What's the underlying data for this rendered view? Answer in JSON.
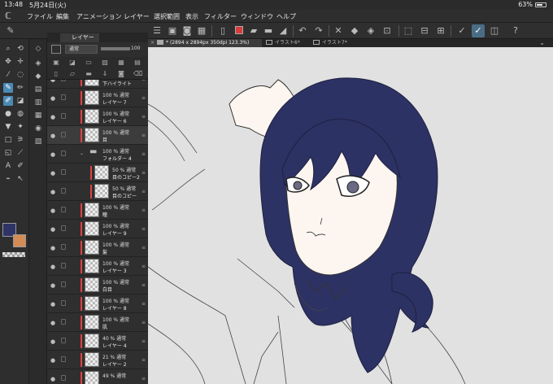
{
  "status": {
    "time": "13:48",
    "date": "5月24日(火)",
    "battery": "63%"
  },
  "menu": [
    "ファイル",
    "編集",
    "アニメーション",
    "レイヤー",
    "選択範囲",
    "表示",
    "フィルター",
    "ウィンドウ",
    "ヘルプ"
  ],
  "colors": {
    "main": "#2e3466",
    "sub": "#d48c55",
    "accent": "#4a8ab5",
    "toolbar_red": "#d93b3b"
  },
  "layer_panel": {
    "tab_label": "レイヤー",
    "blend_mode": "通常",
    "opacity": "100",
    "layers": [
      {
        "opacity": "",
        "name": "下ハイライト"
      },
      {
        "opacity": "100 % 通常",
        "name": "レイヤー 7"
      },
      {
        "opacity": "100 % 通常",
        "name": "レイヤー 6"
      },
      {
        "opacity": "100 % 通常",
        "name": "目"
      },
      {
        "opacity": "100 % 通常",
        "name": "フォルダー 4"
      },
      {
        "opacity": "50 % 通常",
        "name": "目のコピー2"
      },
      {
        "opacity": "50 % 通常",
        "name": "目のコピー"
      },
      {
        "opacity": "100 % 通常",
        "name": "瞳"
      },
      {
        "opacity": "100 % 通常",
        "name": "レイヤー 9"
      },
      {
        "opacity": "100 % 通常",
        "name": "髪"
      },
      {
        "opacity": "100 % 通常",
        "name": "レイヤー 3"
      },
      {
        "opacity": "100 % 通常",
        "name": "白目"
      },
      {
        "opacity": "100 % 通常",
        "name": "レイヤー 8"
      },
      {
        "opacity": "100 % 通常",
        "name": "肌"
      },
      {
        "opacity": "40 % 通常",
        "name": "レイヤー 4"
      },
      {
        "opacity": "21 % 通常",
        "name": "レイヤー 2"
      },
      {
        "opacity": "49 % 通常",
        "name": ""
      }
    ]
  },
  "canvas_tabs": [
    {
      "label": "* (2894 x 2894px 350dpi 123.3%)",
      "active": true
    },
    {
      "label": "イラスト6*",
      "active": false
    },
    {
      "label": "イラスト7*",
      "active": false
    }
  ],
  "artwork": {
    "hair_color": "#2d3264",
    "skin_color": "#fdf6f0",
    "line_color": "#333333"
  }
}
